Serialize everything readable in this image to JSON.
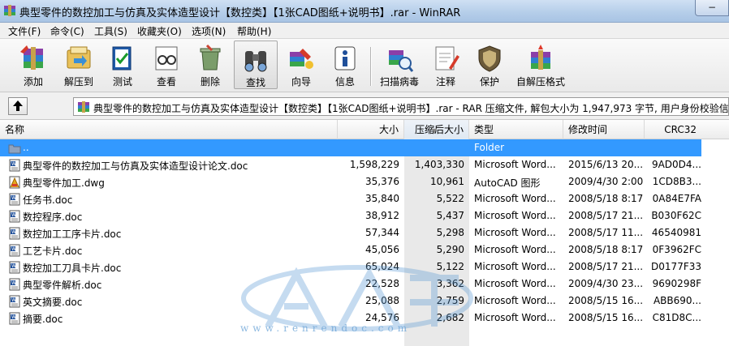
{
  "window": {
    "title": "典型零件的数控加工与仿真及实体造型设计【数控类】【1张CAD图纸+说明书】.rar - WinRAR",
    "minimize_glyph": "−"
  },
  "menu": [
    "文件(F)",
    "命令(C)",
    "工具(S)",
    "收藏夹(O)",
    "选项(N)",
    "帮助(H)"
  ],
  "toolbar": [
    {
      "label": "添加",
      "icon": "add-archive-icon"
    },
    {
      "label": "解压到",
      "icon": "extract-to-icon"
    },
    {
      "label": "测试",
      "icon": "test-icon"
    },
    {
      "label": "查看",
      "icon": "view-icon"
    },
    {
      "label": "删除",
      "icon": "delete-icon"
    },
    {
      "label": "查找",
      "icon": "find-binoculars-icon"
    },
    {
      "label": "向导",
      "icon": "wizard-icon"
    },
    {
      "label": "信息",
      "icon": "info-icon"
    },
    {
      "label": "扫描病毒",
      "icon": "scan-virus-icon"
    },
    {
      "label": "注释",
      "icon": "comment-icon"
    },
    {
      "label": "保护",
      "icon": "protect-shield-icon"
    },
    {
      "label": "自解压格式",
      "icon": "sfx-icon"
    }
  ],
  "address": {
    "text": "典型零件的数控加工与仿真及实体造型设计【数控类】【1张CAD图纸+说明书】.rar - RAR 压缩文件, 解包大小为 1,947,973 字节, 用户身份校验信息"
  },
  "columns": {
    "name": "名称",
    "size": "大小",
    "packed": "压缩后大小",
    "type": "类型",
    "modified": "修改时间",
    "crc": "CRC32"
  },
  "files": [
    {
      "name": "..",
      "size": "",
      "packed": "",
      "type": "Folder",
      "modified": "",
      "crc": "",
      "icon": "folder-up-icon",
      "selected": true
    },
    {
      "name": "典型零件的数控加工与仿真及实体造型设计论文.doc",
      "size": "1,598,229",
      "packed": "1,403,330",
      "type": "Microsoft Word...",
      "modified": "2015/6/13 20...",
      "crc": "9AD0D4...",
      "icon": "word-doc-icon"
    },
    {
      "name": "典型零件加工.dwg",
      "size": "35,376",
      "packed": "10,961",
      "type": "AutoCAD 图形",
      "modified": "2009/4/30 2:00",
      "crc": "1CD8B3...",
      "icon": "autocad-dwg-icon"
    },
    {
      "name": "任务书.doc",
      "size": "35,840",
      "packed": "5,522",
      "type": "Microsoft Word...",
      "modified": "2008/5/18 8:17",
      "crc": "0A84E7FA",
      "icon": "word-doc-icon"
    },
    {
      "name": "数控程序.doc",
      "size": "38,912",
      "packed": "5,437",
      "type": "Microsoft Word...",
      "modified": "2008/5/17 21...",
      "crc": "B030F62C",
      "icon": "word-doc-icon"
    },
    {
      "name": "数控加工工序卡片.doc",
      "size": "57,344",
      "packed": "5,298",
      "type": "Microsoft Word...",
      "modified": "2008/5/17 11...",
      "crc": "46540981",
      "icon": "word-doc-icon"
    },
    {
      "name": "工艺卡片.doc",
      "size": "45,056",
      "packed": "5,290",
      "type": "Microsoft Word...",
      "modified": "2008/5/18 8:17",
      "crc": "0F3962FC",
      "icon": "word-doc-icon"
    },
    {
      "name": "数控加工刀具卡片.doc",
      "size": "65,024",
      "packed": "5,122",
      "type": "Microsoft Word...",
      "modified": "2008/5/17 21...",
      "crc": "D0177F33",
      "icon": "word-doc-icon"
    },
    {
      "name": "典型零件解析.doc",
      "size": "22,528",
      "packed": "3,362",
      "type": "Microsoft Word...",
      "modified": "2009/4/30 23...",
      "crc": "9690298F",
      "icon": "word-doc-icon"
    },
    {
      "name": "英文摘要.doc",
      "size": "25,088",
      "packed": "2,759",
      "type": "Microsoft Word...",
      "modified": "2008/5/15 16...",
      "crc": "ABB690...",
      "icon": "word-doc-icon"
    },
    {
      "name": "摘要.doc",
      "size": "24,576",
      "packed": "2,682",
      "type": "Microsoft Word...",
      "modified": "2008/5/15 16...",
      "crc": "C81D8C...",
      "icon": "word-doc-icon"
    }
  ],
  "watermark": {
    "url": "www.renrendoc.com"
  },
  "colors": {
    "selection": "#3399ff",
    "accent": "#2d6fb8"
  }
}
